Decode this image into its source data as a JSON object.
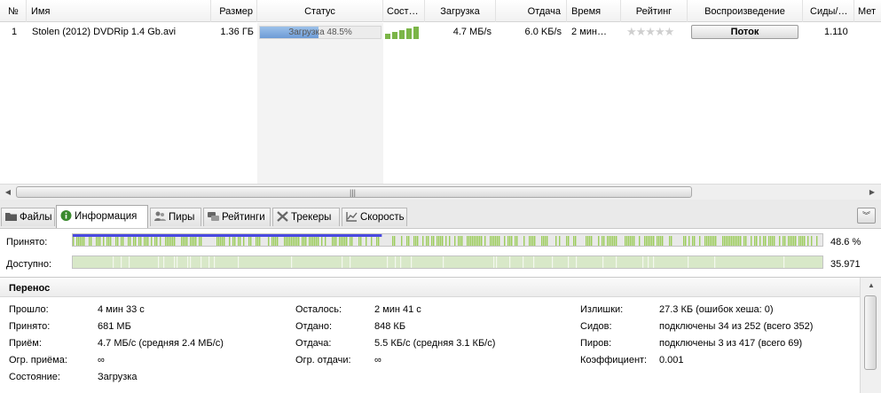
{
  "columns": {
    "num": "№",
    "name": "Имя",
    "size": "Размер",
    "status": "Статус",
    "state": "Сост…",
    "download": "Загрузка",
    "upload": "Отдача",
    "time": "Время",
    "rating": "Рейтинг",
    "playback": "Воспроизведение",
    "seeds": "Сиды/…",
    "meta": "Мет"
  },
  "torrent": {
    "num": "1",
    "name": "Stolen (2012) DVDRip 1.4 Gb.avi",
    "size": "1.36 ГБ",
    "status_text": "Загрузка 48.5%",
    "progress": 0.485,
    "download": "4.7 MБ/s",
    "upload": "6.0 KБ/s",
    "time": "2 мин…",
    "rating_stars": "★★★★★",
    "rating_value": 0,
    "stream_label": "Поток",
    "seeds": "1.110",
    "signal_level": 5
  },
  "tabs": [
    {
      "label": "Файлы",
      "icon": "folder-icon"
    },
    {
      "label": "Информация",
      "icon": "info-icon"
    },
    {
      "label": "Пиры",
      "icon": "peers-icon"
    },
    {
      "label": "Рейтинги",
      "icon": "ratings-icon"
    },
    {
      "label": "Трекеры",
      "icon": "trackers-icon"
    },
    {
      "label": "Скорость",
      "icon": "speed-icon"
    }
  ],
  "active_tab": 1,
  "pieces": {
    "received_label": "Принято:",
    "received_value": "48.6 %",
    "received_fraction": 0.486,
    "available_label": "Доступно:",
    "available_value": "35.971"
  },
  "transfer": {
    "title": "Перенос",
    "col1": [
      {
        "label": "Прошло:",
        "value": "4 мин 33 с"
      },
      {
        "label": "Принято:",
        "value": "681 МБ"
      },
      {
        "label": "Приём:",
        "value": "4.7 МБ/с (средняя 2.4 МБ/с)"
      },
      {
        "label": "Огр. приёма:",
        "value": "∞"
      },
      {
        "label": "Состояние:",
        "value": "Загрузка"
      }
    ],
    "col2": [
      {
        "label": "Осталось:",
        "value": "2 мин 41 с"
      },
      {
        "label": "Отдано:",
        "value": "848 КБ"
      },
      {
        "label": "Отдача:",
        "value": "5.5 КБ/с (средняя 3.1 КБ/с)"
      },
      {
        "label": "Огр. отдачи:",
        "value": "∞"
      }
    ],
    "col3": [
      {
        "label": "Излишки:",
        "value": "27.3 КБ (ошибок хеша: 0)"
      },
      {
        "label": "Сидов:",
        "value": "подключены 34 из 252 (всего 352)"
      },
      {
        "label": "Пиров:",
        "value": "подключены 3 из 417 (всего 69)"
      },
      {
        "label": "Коэффициент:",
        "value": "0.001"
      }
    ]
  },
  "colors": {
    "piece_green": "#9ccc5c",
    "piece_light": "#d8e8c8",
    "progress_blue": "#4a4ae0",
    "progress_fill": "#7aa7dd"
  }
}
